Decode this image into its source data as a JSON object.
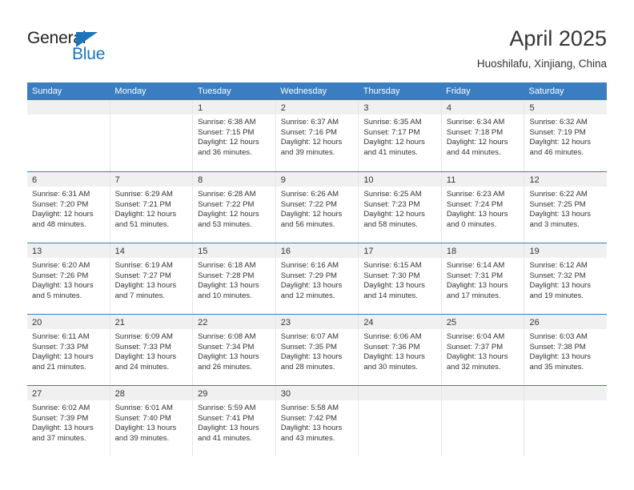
{
  "brand": {
    "name_part1": "General",
    "name_part2": "Blue",
    "triangle_icon": "triangle-icon",
    "color_dark": "#231f20",
    "color_blue": "#1b75bb"
  },
  "header": {
    "title": "April 2025",
    "subtitle": "Huoshilafu, Xinjiang, China"
  },
  "calendar": {
    "accent_color": "#3a7dc0",
    "day_strip_color": "#f0f0f0",
    "weekdays": [
      "Sunday",
      "Monday",
      "Tuesday",
      "Wednesday",
      "Thursday",
      "Friday",
      "Saturday"
    ],
    "weeks": [
      [
        {
          "empty": true
        },
        {
          "empty": true
        },
        {
          "day": "1",
          "sunrise": "Sunrise: 6:38 AM",
          "sunset": "Sunset: 7:15 PM",
          "daylight1": "Daylight: 12 hours",
          "daylight2": "and 36 minutes."
        },
        {
          "day": "2",
          "sunrise": "Sunrise: 6:37 AM",
          "sunset": "Sunset: 7:16 PM",
          "daylight1": "Daylight: 12 hours",
          "daylight2": "and 39 minutes."
        },
        {
          "day": "3",
          "sunrise": "Sunrise: 6:35 AM",
          "sunset": "Sunset: 7:17 PM",
          "daylight1": "Daylight: 12 hours",
          "daylight2": "and 41 minutes."
        },
        {
          "day": "4",
          "sunrise": "Sunrise: 6:34 AM",
          "sunset": "Sunset: 7:18 PM",
          "daylight1": "Daylight: 12 hours",
          "daylight2": "and 44 minutes."
        },
        {
          "day": "5",
          "sunrise": "Sunrise: 6:32 AM",
          "sunset": "Sunset: 7:19 PM",
          "daylight1": "Daylight: 12 hours",
          "daylight2": "and 46 minutes."
        }
      ],
      [
        {
          "day": "6",
          "sunrise": "Sunrise: 6:31 AM",
          "sunset": "Sunset: 7:20 PM",
          "daylight1": "Daylight: 12 hours",
          "daylight2": "and 48 minutes."
        },
        {
          "day": "7",
          "sunrise": "Sunrise: 6:29 AM",
          "sunset": "Sunset: 7:21 PM",
          "daylight1": "Daylight: 12 hours",
          "daylight2": "and 51 minutes."
        },
        {
          "day": "8",
          "sunrise": "Sunrise: 6:28 AM",
          "sunset": "Sunset: 7:22 PM",
          "daylight1": "Daylight: 12 hours",
          "daylight2": "and 53 minutes."
        },
        {
          "day": "9",
          "sunrise": "Sunrise: 6:26 AM",
          "sunset": "Sunset: 7:22 PM",
          "daylight1": "Daylight: 12 hours",
          "daylight2": "and 56 minutes."
        },
        {
          "day": "10",
          "sunrise": "Sunrise: 6:25 AM",
          "sunset": "Sunset: 7:23 PM",
          "daylight1": "Daylight: 12 hours",
          "daylight2": "and 58 minutes."
        },
        {
          "day": "11",
          "sunrise": "Sunrise: 6:23 AM",
          "sunset": "Sunset: 7:24 PM",
          "daylight1": "Daylight: 13 hours",
          "daylight2": "and 0 minutes."
        },
        {
          "day": "12",
          "sunrise": "Sunrise: 6:22 AM",
          "sunset": "Sunset: 7:25 PM",
          "daylight1": "Daylight: 13 hours",
          "daylight2": "and 3 minutes."
        }
      ],
      [
        {
          "day": "13",
          "sunrise": "Sunrise: 6:20 AM",
          "sunset": "Sunset: 7:26 PM",
          "daylight1": "Daylight: 13 hours",
          "daylight2": "and 5 minutes."
        },
        {
          "day": "14",
          "sunrise": "Sunrise: 6:19 AM",
          "sunset": "Sunset: 7:27 PM",
          "daylight1": "Daylight: 13 hours",
          "daylight2": "and 7 minutes."
        },
        {
          "day": "15",
          "sunrise": "Sunrise: 6:18 AM",
          "sunset": "Sunset: 7:28 PM",
          "daylight1": "Daylight: 13 hours",
          "daylight2": "and 10 minutes."
        },
        {
          "day": "16",
          "sunrise": "Sunrise: 6:16 AM",
          "sunset": "Sunset: 7:29 PM",
          "daylight1": "Daylight: 13 hours",
          "daylight2": "and 12 minutes."
        },
        {
          "day": "17",
          "sunrise": "Sunrise: 6:15 AM",
          "sunset": "Sunset: 7:30 PM",
          "daylight1": "Daylight: 13 hours",
          "daylight2": "and 14 minutes."
        },
        {
          "day": "18",
          "sunrise": "Sunrise: 6:14 AM",
          "sunset": "Sunset: 7:31 PM",
          "daylight1": "Daylight: 13 hours",
          "daylight2": "and 17 minutes."
        },
        {
          "day": "19",
          "sunrise": "Sunrise: 6:12 AM",
          "sunset": "Sunset: 7:32 PM",
          "daylight1": "Daylight: 13 hours",
          "daylight2": "and 19 minutes."
        }
      ],
      [
        {
          "day": "20",
          "sunrise": "Sunrise: 6:11 AM",
          "sunset": "Sunset: 7:33 PM",
          "daylight1": "Daylight: 13 hours",
          "daylight2": "and 21 minutes."
        },
        {
          "day": "21",
          "sunrise": "Sunrise: 6:09 AM",
          "sunset": "Sunset: 7:33 PM",
          "daylight1": "Daylight: 13 hours",
          "daylight2": "and 24 minutes."
        },
        {
          "day": "22",
          "sunrise": "Sunrise: 6:08 AM",
          "sunset": "Sunset: 7:34 PM",
          "daylight1": "Daylight: 13 hours",
          "daylight2": "and 26 minutes."
        },
        {
          "day": "23",
          "sunrise": "Sunrise: 6:07 AM",
          "sunset": "Sunset: 7:35 PM",
          "daylight1": "Daylight: 13 hours",
          "daylight2": "and 28 minutes."
        },
        {
          "day": "24",
          "sunrise": "Sunrise: 6:06 AM",
          "sunset": "Sunset: 7:36 PM",
          "daylight1": "Daylight: 13 hours",
          "daylight2": "and 30 minutes."
        },
        {
          "day": "25",
          "sunrise": "Sunrise: 6:04 AM",
          "sunset": "Sunset: 7:37 PM",
          "daylight1": "Daylight: 13 hours",
          "daylight2": "and 32 minutes."
        },
        {
          "day": "26",
          "sunrise": "Sunrise: 6:03 AM",
          "sunset": "Sunset: 7:38 PM",
          "daylight1": "Daylight: 13 hours",
          "daylight2": "and 35 minutes."
        }
      ],
      [
        {
          "day": "27",
          "sunrise": "Sunrise: 6:02 AM",
          "sunset": "Sunset: 7:39 PM",
          "daylight1": "Daylight: 13 hours",
          "daylight2": "and 37 minutes."
        },
        {
          "day": "28",
          "sunrise": "Sunrise: 6:01 AM",
          "sunset": "Sunset: 7:40 PM",
          "daylight1": "Daylight: 13 hours",
          "daylight2": "and 39 minutes."
        },
        {
          "day": "29",
          "sunrise": "Sunrise: 5:59 AM",
          "sunset": "Sunset: 7:41 PM",
          "daylight1": "Daylight: 13 hours",
          "daylight2": "and 41 minutes."
        },
        {
          "day": "30",
          "sunrise": "Sunrise: 5:58 AM",
          "sunset": "Sunset: 7:42 PM",
          "daylight1": "Daylight: 13 hours",
          "daylight2": "and 43 minutes."
        },
        {
          "empty": true
        },
        {
          "empty": true
        },
        {
          "empty": true
        }
      ]
    ]
  }
}
